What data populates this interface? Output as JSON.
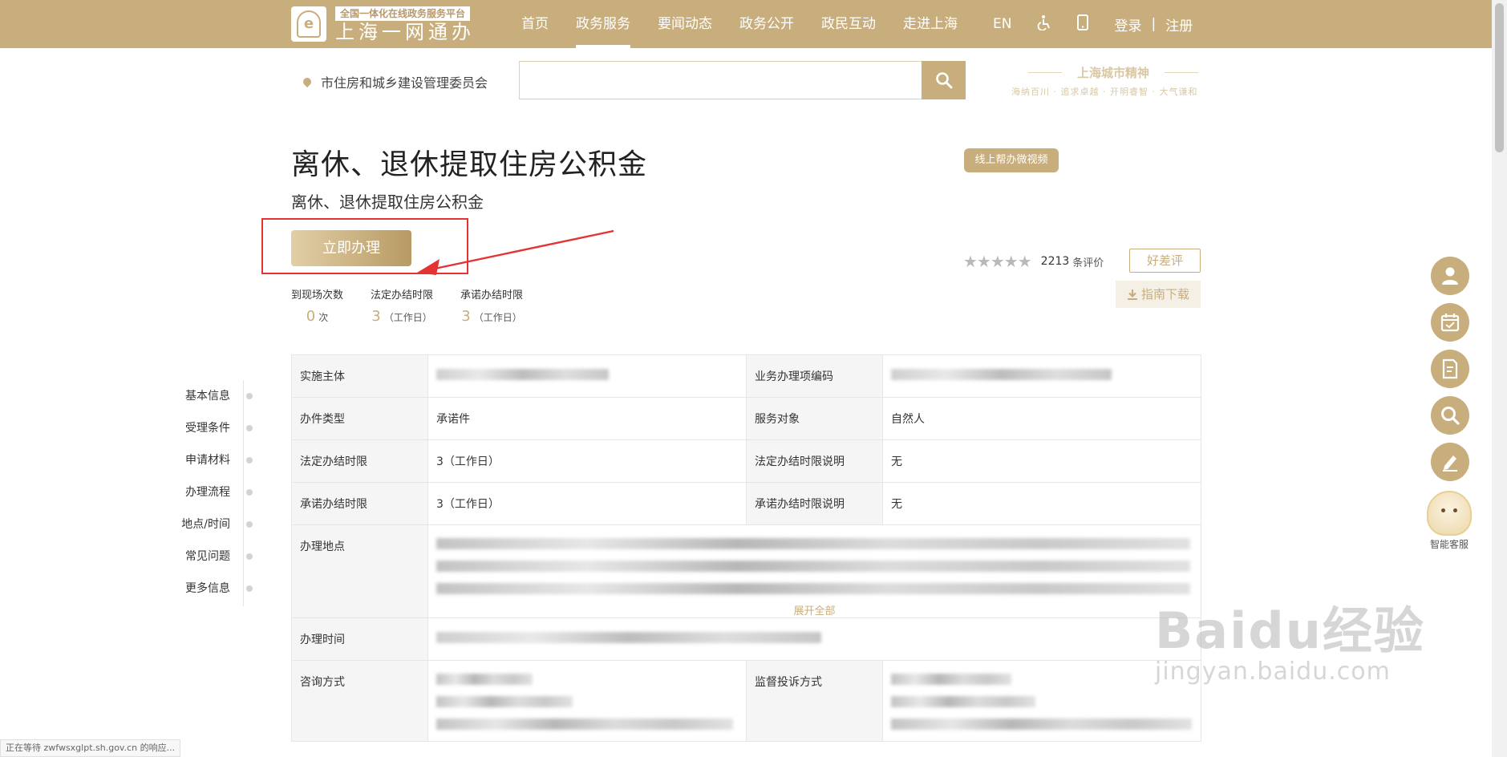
{
  "colors": {
    "brand": "#c8ae7d",
    "highlight": "#e53333"
  },
  "header": {
    "brand_sub": "全国一体化在线政务服务平台",
    "brand_main": "上海一网通办",
    "nav": [
      "首页",
      "政务服务",
      "要闻动态",
      "政务公开",
      "政民互动",
      "走进上海"
    ],
    "active_nav": "政务服务",
    "lang": "EN",
    "accessibility_icon": "accessibility-icon",
    "mobile_icon": "mobile-icon",
    "login": "登录",
    "separator": "|",
    "register": "注册"
  },
  "search": {
    "location": "市住房和城乡建设管理委员会",
    "placeholder": "",
    "button_icon": "search-icon"
  },
  "spirit": {
    "title": "上海城市精神",
    "subtitle": "海纳百川 · 追求卓越 · 开明睿智 · 大气谦和"
  },
  "page": {
    "title": "离休、退休提取住房公积金",
    "subtitle": "离休、退休提取住房公积金",
    "video_button": "线上帮办微视频",
    "apply_button": "立即办理"
  },
  "stats": [
    {
      "label": "到现场次数",
      "value": "0",
      "unit": "次"
    },
    {
      "label": "法定办结时限",
      "value": "3",
      "unit": "（工作日）"
    },
    {
      "label": "承诺办结时限",
      "value": "3",
      "unit": "（工作日）"
    }
  ],
  "rating": {
    "stars": "★★★★★",
    "count": "2213",
    "unit": "条评价",
    "review_button": "好差评",
    "guide_button": "指南下载"
  },
  "anchors": [
    "基本信息",
    "受理条件",
    "申请材料",
    "办理流程",
    "地点/时间",
    "常见问题",
    "更多信息"
  ],
  "table": {
    "r1": {
      "l1": "实施主体",
      "l2": "业务办理项编码"
    },
    "r2": {
      "l1": "办件类型",
      "v1": "承诺件",
      "l2": "服务对象",
      "v2": "自然人"
    },
    "r3": {
      "l1": "法定办结时限",
      "v1": "3（工作日）",
      "l2": "法定办结时限说明",
      "v2": "无"
    },
    "r4": {
      "l1": "承诺办结时限",
      "v1": "3（工作日）",
      "l2": "承诺办结时限说明",
      "v2": "无"
    },
    "r5": {
      "l1": "办理地点",
      "expand": "展开全部"
    },
    "r6": {
      "l1": "办理时间"
    },
    "r7": {
      "l1": "咨询方式",
      "l2": "监督投诉方式"
    }
  },
  "float_tools": [
    "user-icon",
    "calendar-icon",
    "document-icon",
    "search-icon",
    "edit-icon"
  ],
  "kefu_label": "智能客服",
  "status_text": "正在等待 zwfwsxglpt.sh.gov.cn 的响应...",
  "watermark": {
    "main": "Baidu经验",
    "sub": "jingyan.baidu.com"
  }
}
